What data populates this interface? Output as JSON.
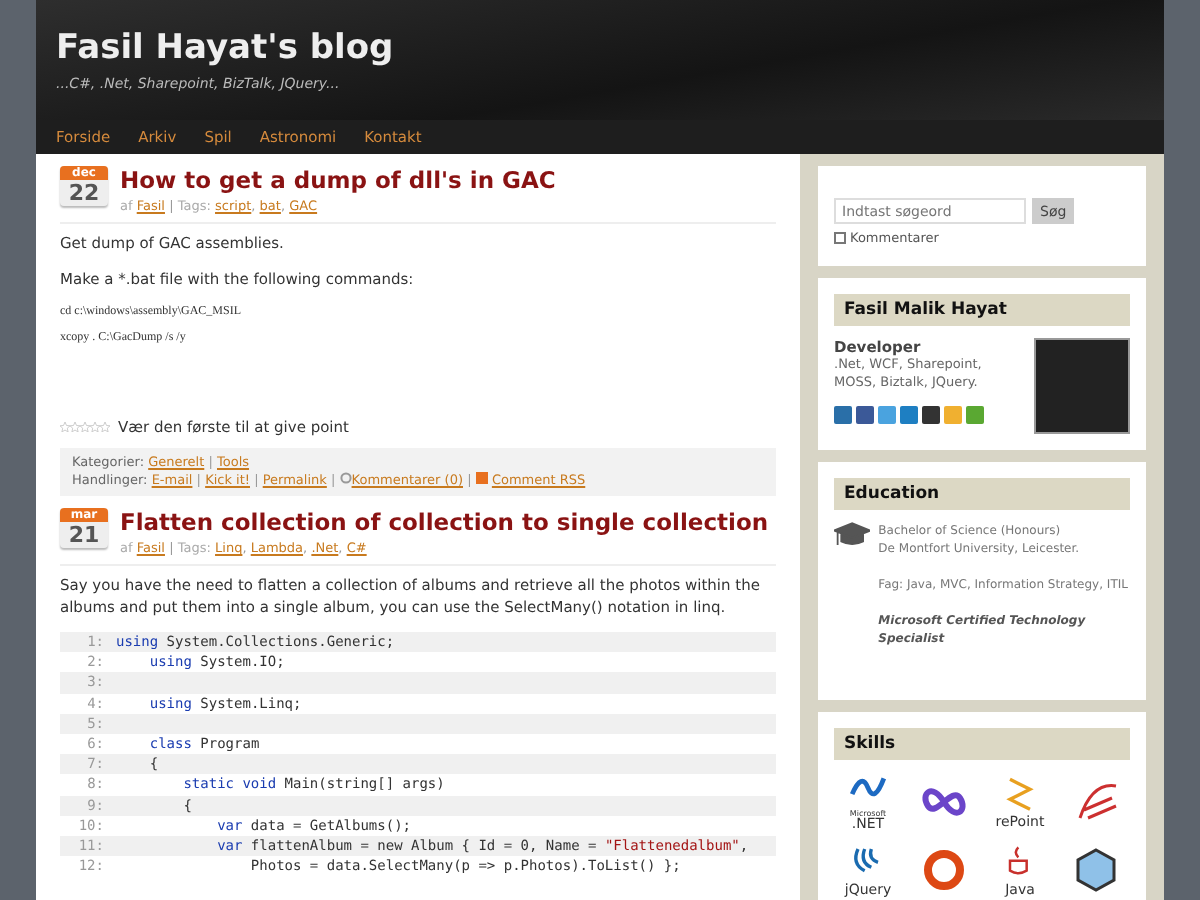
{
  "header": {
    "title": "Fasil Hayat's blog",
    "tagline": "...C#, .Net, Sharepoint, BizTalk, JQuery..."
  },
  "nav": [
    "Forside",
    "Arkiv",
    "Spil",
    "Astronomi",
    "Kontakt"
  ],
  "posts": [
    {
      "month": "dec",
      "day": "22",
      "title": "How to get a dump of dll's in GAC",
      "by": "af",
      "author": "Fasil",
      "separator": "|",
      "tags_label": "Tags:",
      "tags": [
        {
          "label": "script",
          "after": ","
        },
        {
          "label": "bat",
          "after": ","
        },
        {
          "label": "GAC"
        }
      ],
      "paragraphs": [
        "Get dump of GAC assemblies.",
        "Make a *.bat file with the following commands:"
      ],
      "commands": [
        "cd  c:\\windows\\assembly\\GAC_MSIL",
        "xcopy . C:\\GacDump /s /y"
      ],
      "stars": 0,
      "rating_text": "Vær den første til at give point",
      "categories_label": "Kategorier:",
      "categories": [
        {
          "label": "Generelt",
          "after": "|"
        },
        {
          "label": "Tools"
        }
      ],
      "actions_label": "Handlinger:",
      "actions": [
        {
          "label": "E-mail",
          "kind": "link",
          "after": "|"
        },
        {
          "label": "Kick it!",
          "kind": "link",
          "after": "|"
        },
        {
          "label": "Permalink",
          "kind": "link",
          "after": "|"
        },
        {
          "label": "Kommentarer (0)",
          "kind": "comments",
          "after": "|"
        },
        {
          "label": "Comment RSS",
          "kind": "rss"
        }
      ]
    },
    {
      "month": "mar",
      "day": "21",
      "title": "Flatten collection of collection to single collection",
      "by": "af",
      "author": "Fasil",
      "separator": "|",
      "tags_label": "Tags:",
      "tags": [
        {
          "label": "Linq",
          "after": ","
        },
        {
          "label": "Lambda",
          "after": ","
        },
        {
          "label": ".Net",
          "after": ","
        },
        {
          "label": "C#"
        }
      ],
      "paragraphs": [
        "Say you have the need to flatten a collection of albums and retrieve all the photos within the albums and put them into a single album, you can use the SelectMany() notation in linq."
      ],
      "code": [
        {
          "num": "1:",
          "tokens": [
            {
              "kind": "keyword",
              "text": "using"
            },
            {
              "kind": "plain",
              "text": " System.Collections.Generic;"
            }
          ]
        },
        {
          "num": "2:",
          "tokens": [
            {
              "kind": "keyword",
              "text": "    using"
            },
            {
              "kind": "plain",
              "text": " System.IO;"
            }
          ]
        },
        {
          "num": "3:"
        },
        {
          "num": "4:",
          "tokens": [
            {
              "kind": "keyword",
              "text": "    using"
            },
            {
              "kind": "plain",
              "text": " System.Linq;"
            }
          ]
        },
        {
          "num": "5:"
        },
        {
          "num": "6:",
          "tokens": [
            {
              "kind": "keyword",
              "text": "    class"
            },
            {
              "kind": "plain",
              "text": " Program"
            }
          ]
        },
        {
          "num": "7:",
          "tokens": [
            {
              "kind": "plain",
              "text": "    {"
            }
          ]
        },
        {
          "num": "8:",
          "tokens": [
            {
              "kind": "keyword",
              "text": "        static void"
            },
            {
              "kind": "plain",
              "text": " Main(string[] args)"
            }
          ]
        },
        {
          "num": "9:",
          "tokens": [
            {
              "kind": "plain",
              "text": "        {"
            }
          ]
        },
        {
          "num": "10:",
          "tokens": [
            {
              "kind": "keyword",
              "text": "            var"
            },
            {
              "kind": "plain",
              "text": " data = GetAlbums();"
            }
          ]
        },
        {
          "num": "11:",
          "tokens": [
            {
              "kind": "keyword",
              "text": "            var"
            },
            {
              "kind": "plain",
              "text": " flattenAlbum = new Album { Id = 0, Name = "
            },
            {
              "kind": "string",
              "text": "\"Flattenedalbum\""
            },
            {
              "kind": "plain",
              "text": ","
            }
          ]
        },
        {
          "num": "12:",
          "tokens": [
            {
              "kind": "plain",
              "text": "                Photos = data.SelectMany(p => p.Photos).ToList() };"
            }
          ]
        }
      ]
    }
  ],
  "search": {
    "placeholder": "Indtast søgeord",
    "button": "Søg",
    "option": "Kommentarer",
    "checked": false
  },
  "profile": {
    "name": "Fasil Malik Hayat",
    "role": "Developer",
    "skills": ".Net, WCF, Sharepoint, MOSS, Biztalk, JQuery.",
    "social": [
      {
        "color": "#2a6fa8"
      },
      {
        "color": "#3b5998"
      },
      {
        "color": "#4aa3df"
      },
      {
        "color": "#1e7fc2"
      },
      {
        "color": "#333333"
      },
      {
        "color": "#f0b030"
      },
      {
        "color": "#5aa832"
      }
    ]
  },
  "education": {
    "heading": "Education",
    "degree": "Bachelor of Science (Honours)",
    "university": "De Montfort University, Leicester.",
    "subjects": "Fag: Java, MVC, Information Strategy, ITIL",
    "certification": "Microsoft Certified Technology Specialist"
  },
  "skills": {
    "heading": "Skills",
    "logos": [
      {
        "kind": "dotnet",
        "label": ".NET",
        "sub": "Microsoft"
      },
      {
        "kind": "infinity"
      },
      {
        "kind": "sharepoint",
        "label": "rePoint"
      },
      {
        "kind": "sql"
      },
      {
        "kind": "jquery",
        "label": "jQuery"
      },
      {
        "kind": "ubuntu"
      },
      {
        "kind": "java",
        "label": "Java"
      },
      {
        "kind": "cube"
      }
    ]
  }
}
